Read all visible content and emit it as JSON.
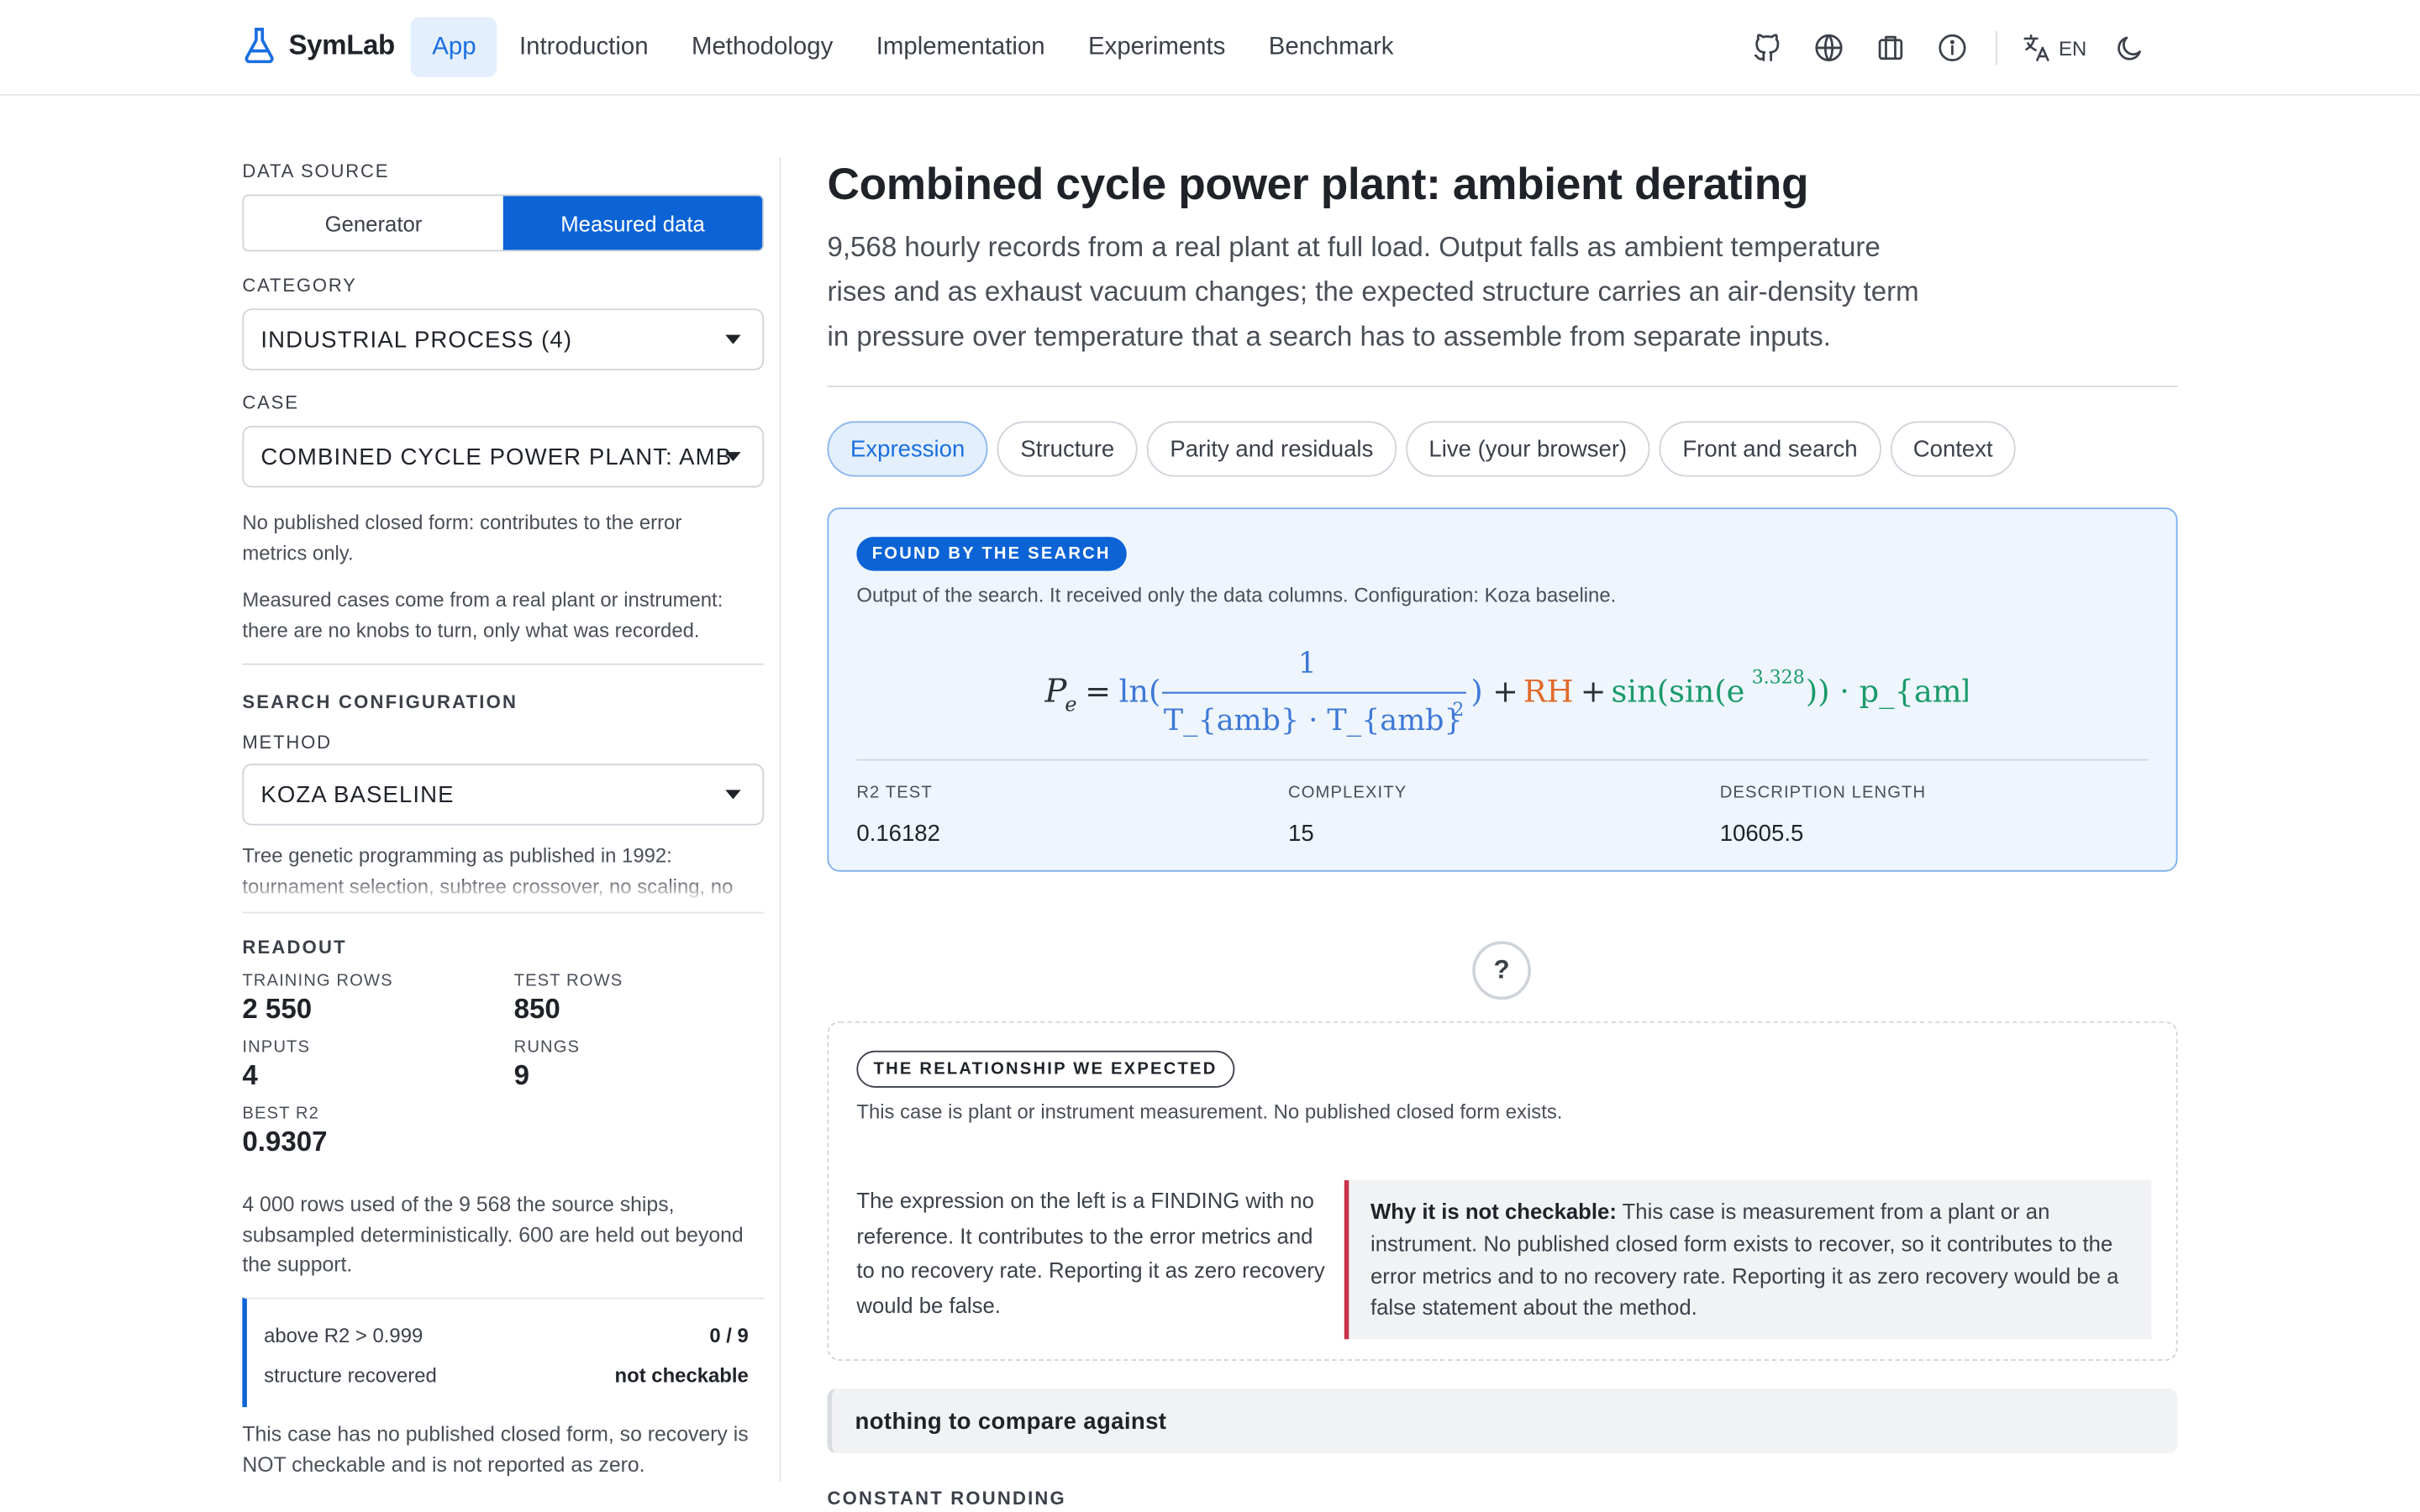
{
  "header": {
    "brand": "SymLab",
    "nav": [
      "App",
      "Introduction",
      "Methodology",
      "Implementation",
      "Experiments",
      "Benchmark"
    ],
    "lang": "EN"
  },
  "sidebar": {
    "data_source_label": "DATA SOURCE",
    "seg_generator": "Generator",
    "seg_measured": "Measured data",
    "category_label": "CATEGORY",
    "category_value": "INDUSTRIAL PROCESS (4)",
    "case_label": "CASE",
    "case_value": "COMBINED CYCLE POWER PLANT: AMB",
    "note1": "No published closed form: contributes to the error metrics only.",
    "note2": "Measured cases come from a real plant or instrument: there are no knobs to turn, only what was recorded.",
    "search_config_label": "SEARCH CONFIGURATION",
    "method_label": "METHOD",
    "method_value": "KOZA BASELINE",
    "method_desc": "Tree genetic programming as published in 1992: tournament selection, subtree crossover, no scaling, no",
    "readout_label": "READOUT",
    "training_rows_label": "TRAINING ROWS",
    "training_rows": "2 550",
    "test_rows_label": "TEST ROWS",
    "test_rows": "850",
    "inputs_label": "INPUTS",
    "inputs": "4",
    "rungs_label": "RUNGS",
    "rungs": "9",
    "best_r2_label": "BEST R2",
    "best_r2": "0.9307",
    "rows_note": "4 000 rows used of the 9 568 the source ships, subsampled deterministically. 600 are held out beyond the support.",
    "above_label": "above R2 > 0.999",
    "above_value": "0 / 9",
    "structure_label": "structure recovered",
    "structure_value": "not checkable",
    "closing_note": "This case has no published closed form, so recovery is NOT checkable and is not reported as zero."
  },
  "main": {
    "title": "Combined cycle power plant: ambient derating",
    "lead": "9,568 hourly records from a real plant at full load. Output falls as ambient temperature rises and as exhaust vacuum changes; the expected structure carries an air-density term in pressure over temperature that a search has to assemble from separate inputs.",
    "tabs": [
      "Expression",
      "Structure",
      "Parity and residuals",
      "Live (your browser)",
      "Front and search",
      "Context"
    ],
    "found_pill": "FOUND BY THE SEARCH",
    "found_desc": "Output of the search. It received only the data columns. Configuration: Koza baseline.",
    "formula": {
      "lhs": "P",
      "lhs_sub": "e",
      "eq": "=",
      "ln": "ln(",
      "num": "1",
      "den": "T_{amb} · T_{amb}",
      "den_sup": "2",
      "close": ")",
      "plus1": "+",
      "rh": "RH",
      "plus2": "+",
      "sin": "sin(sin(e",
      "exp": "3.328",
      "sin_close": ")) · p_{amb}"
    },
    "r2_label": "R2 TEST",
    "r2_value": "0.16182",
    "complexity_label": "COMPLEXITY",
    "complexity_value": "15",
    "dl_label": "DESCRIPTION LENGTH",
    "dl_value": "10605.5",
    "help": "?",
    "expected_pill": "THE RELATIONSHIP WE EXPECTED",
    "expected_desc": "This case is plant or instrument measurement. No published closed form exists.",
    "finding_text": "The expression on the left is a FINDING with no reference. It contributes to the error metrics and to no recovery rate. Reporting it as zero recovery would be false.",
    "why_bold": "Why it is not checkable:",
    "why_text": " This case is measurement from a plant or an instrument. No published closed form exists to recover, so it contributes to the error metrics and to no recovery rate. Reporting it as zero recovery would be a false statement about the method.",
    "nothing": "nothing to compare against",
    "constant_rounding": "CONSTANT ROUNDING"
  }
}
